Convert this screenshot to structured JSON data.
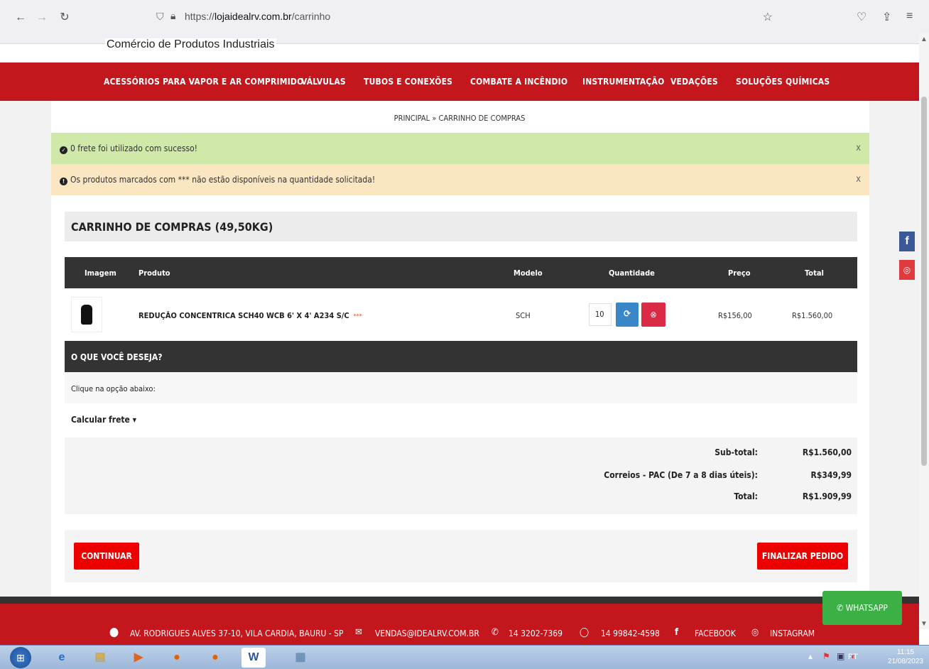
{
  "browser": {
    "url_prefix": "https://",
    "url_domain": "lojaidealrv.com.br",
    "url_path": "/carrinho"
  },
  "header": {
    "store_name": "Comércio de Produtos Industriais"
  },
  "menu": [
    "ACESSÓRIOS PARA VAPOR E AR COMPRIMIDO",
    "VÁLVULAS",
    "TUBOS E CONEXÕES",
    "COMBATE A INCÊNDIO",
    "INSTRUMENTAÇÃO",
    "VEDAÇÕES",
    "SOLUÇÕES QUÍMICAS"
  ],
  "breadcrumb": {
    "home": "PRINCIPAL",
    "separator": "»",
    "current": "CARRINHO DE COMPRAS"
  },
  "alerts": {
    "success": "0 frete foi utilizado com sucesso!",
    "warning": "Os produtos marcados com *** não estão disponíveis na quantidade solicitada!",
    "close": "x"
  },
  "cart": {
    "title": "CARRINHO DE COMPRAS  (49,50KG)",
    "columns": {
      "image": "Imagem",
      "product": "Produto",
      "model": "Modelo",
      "quantity": "Quantidade",
      "price": "Preço",
      "total": "Total"
    },
    "item": {
      "name": "REDUÇÃO CONCENTRICA SCH40 WCB 6' X 4' A234 S/C",
      "unavailable_mark": "***",
      "model": "SCH",
      "quantity": "10",
      "price": "R$156,00",
      "total": "R$1.560,00"
    }
  },
  "options": {
    "heading": "O QUE VOCÊ DESEJA?",
    "note": "Clique na opção abaixo:",
    "shipping_toggle": "Calcular frete ▾"
  },
  "totals": {
    "subtotal_label": "Sub-total:",
    "subtotal_value": "R$1.560,00",
    "shipping_label": "Correios - PAC (De 7 a 8 dias úteis):",
    "shipping_value": "R$349,99",
    "total_label": "Total:",
    "total_value": "R$1.909,99"
  },
  "actions": {
    "continue": "CONTINUAR",
    "finish": "FINALIZAR PEDIDO"
  },
  "footer": {
    "address": "AV. RODRIGUES ALVES 37-10, VILA CARDIA, BAURU - SP",
    "email": "VENDAS@IDEALRV.COM.BR",
    "phone": "14 3202-7369",
    "whatsapp_phone": "14 99842-4598",
    "facebook": "FACEBOOK",
    "instagram": "INSTAGRAM"
  },
  "whatsapp_button": "✆ WHATSAPP",
  "taskbar": {
    "lang": "PT",
    "time": "11:15",
    "date": "21/08/2023"
  },
  "colors": {
    "brand_red": "#c3171d",
    "button_red": "#ee0000",
    "success_bg": "#d0e9a8",
    "warning_bg": "#fbe6c2",
    "dark_bar": "#333333",
    "whatsapp_green": "#3bb044"
  }
}
